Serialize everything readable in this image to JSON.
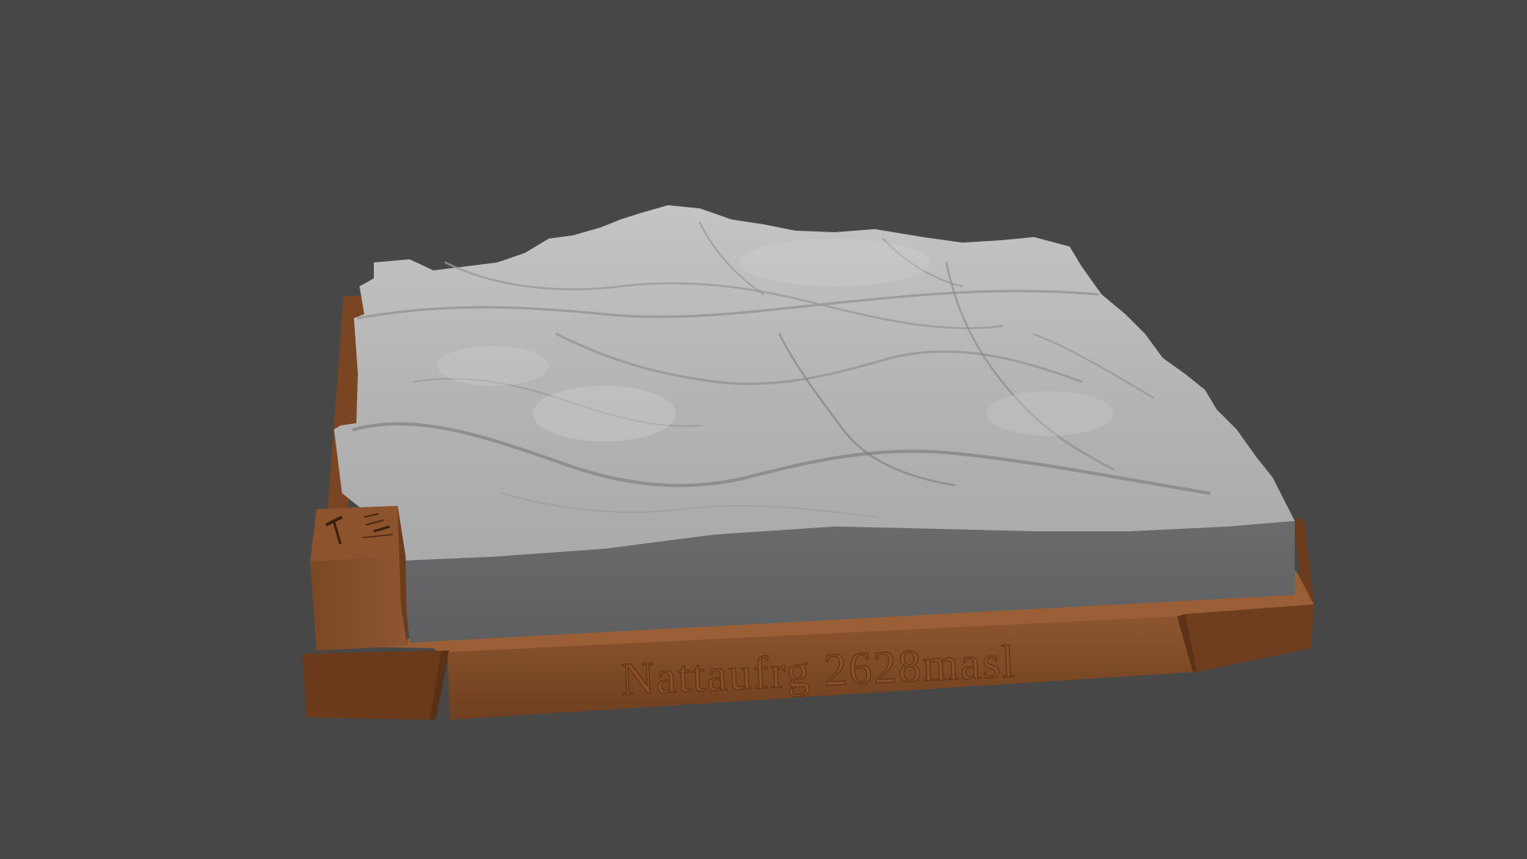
{
  "scene": {
    "background_color": "#474747",
    "model_colors": {
      "terrain": "#b9b9b9",
      "terrain_side": "#636465",
      "base_top": "#8a532e",
      "base_front": "#71401f",
      "base_dark": "#5b3318"
    },
    "plaque": {
      "text": "Nattaufrg 2628masl"
    },
    "side_block": {
      "icons": [
        "hammer-icon",
        "tools-icon"
      ]
    }
  }
}
